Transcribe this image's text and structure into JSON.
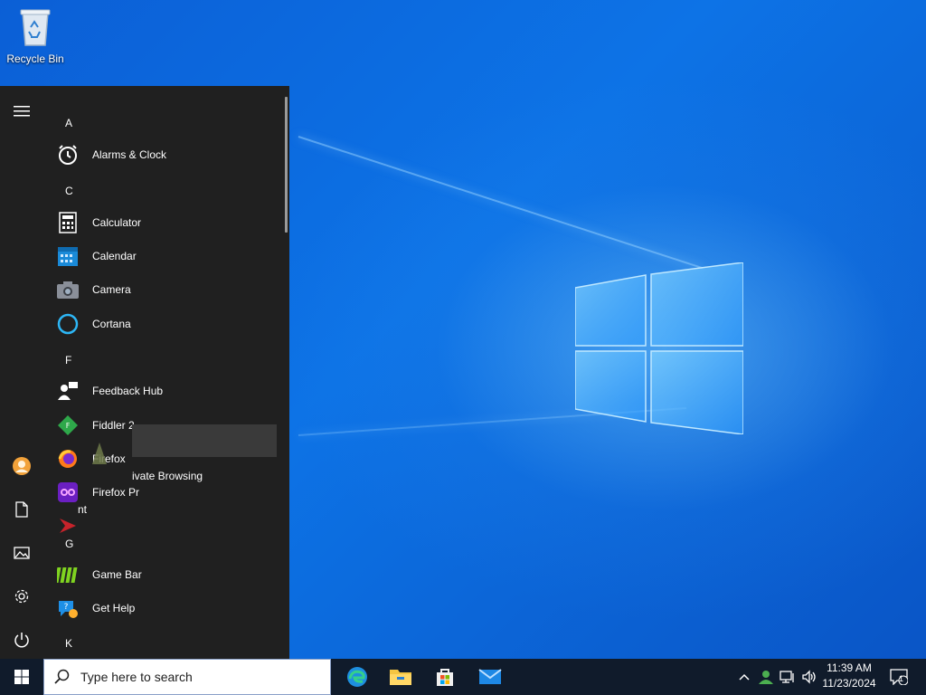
{
  "desktop": {
    "icons": [
      {
        "label": "Recycle Bin",
        "icon": "recycle-bin-icon"
      }
    ]
  },
  "start_menu": {
    "rail": [
      "hamburger-menu-icon",
      "user-avatar-icon",
      "documents-icon",
      "pictures-icon",
      "settings-gear-icon",
      "power-icon"
    ],
    "sections": {
      "A": "A",
      "C": "C",
      "F": "F",
      "G": "G",
      "K": "K"
    },
    "apps": {
      "alarms": "Alarms & Clock",
      "calculator": "Calculator",
      "calendar": "Calendar",
      "camera": "Camera",
      "cortana": "Cortana",
      "feedback_hub": "Feedback Hub",
      "fiddler": "Fiddler 2",
      "firefox": "Firefox",
      "firefox_private": "Firefox Private Browsing",
      "firefox_pr_overlay": "Firefox Pr",
      "unknown_app_suffix": "nt",
      "game_bar": "Game Bar",
      "get_help": "Get Help"
    },
    "drag_overlay_text": "ivate Browsing"
  },
  "taskbar": {
    "search_placeholder": "Type here to search",
    "pinned": [
      "edge-icon",
      "file-explorer-icon",
      "microsoft-store-icon",
      "mail-icon"
    ],
    "tray": [
      "show-hidden-icons-chevron",
      "network-user-icon",
      "network-icon",
      "volume-icon"
    ],
    "clock": {
      "time": "11:39 AM",
      "date": "11/23/2024"
    },
    "notification_count": "1"
  },
  "colors": {
    "start_bg": "#202020",
    "taskbar_bg": "#101b2b",
    "desktop_accent": "#0d73e6"
  }
}
